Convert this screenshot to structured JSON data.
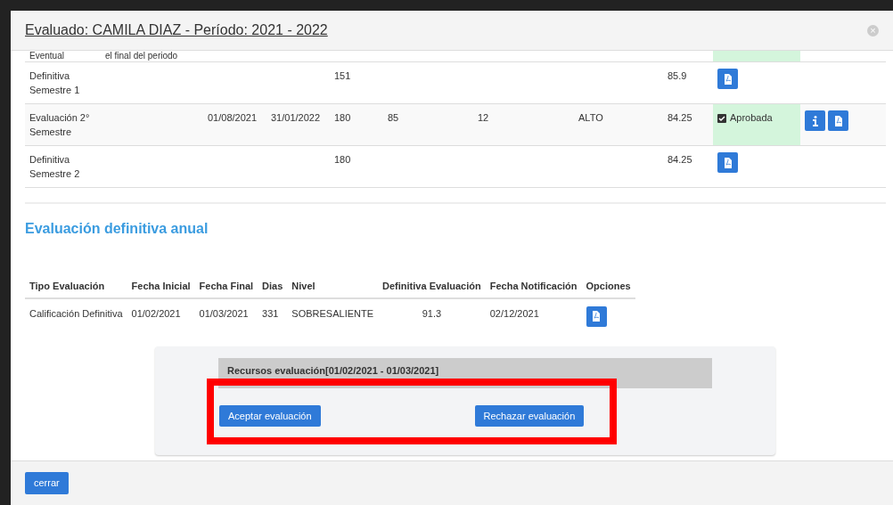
{
  "modal": {
    "title": "Evaluado: CAMILA DIAZ - Período: 2021 - 2022",
    "close_symbol": "×"
  },
  "evaluations": [
    {
      "type": "Eventual",
      "column_2": "el final del periodo",
      "highlighted": true
    },
    {
      "type": "Definitiva Semestre 1",
      "days": "151",
      "score": "85.9",
      "highlighted": false,
      "options": [
        {
          "kind": "pdf"
        }
      ]
    },
    {
      "type": "Evaluación 2° Semestre",
      "start_date": "01/08/2021",
      "end_date": "31/01/2022",
      "days": "180",
      "column_6": "85",
      "column_7": "12",
      "rating": "ALTO",
      "score": "84.25",
      "highlighted": true,
      "status": {
        "label": "Aprobada",
        "checked": true
      },
      "options": [
        {
          "kind": "info"
        },
        {
          "kind": "pdf"
        }
      ]
    },
    {
      "type": "Definitiva Semestre 2",
      "days": "180",
      "score": "84.25",
      "highlighted": false,
      "options": [
        {
          "kind": "pdf"
        }
      ]
    }
  ],
  "annual": {
    "heading": "Evaluación definitiva anual",
    "columns": [
      "Tipo Evaluación",
      "Fecha Inicial",
      "Fecha Final",
      "Dias",
      "Nivel",
      "Definitiva Evaluación",
      "Fecha Notificación",
      "Opciones"
    ],
    "rows": [
      {
        "cells": [
          "Calificación Definitiva",
          "01/02/2021",
          "01/03/2021",
          "331",
          "SOBRESALIENTE",
          "91.3",
          "02/12/2021"
        ],
        "options": [
          {
            "kind": "pdf"
          }
        ]
      }
    ]
  },
  "resources": {
    "title": "Recursos evaluación[01/02/2021 - 01/03/2021]",
    "buttons": [
      "Aceptar evaluación",
      "Rechazar evaluación"
    ],
    "highlighted": true
  },
  "footer": {
    "buttons": [
      "cerrar"
    ]
  }
}
